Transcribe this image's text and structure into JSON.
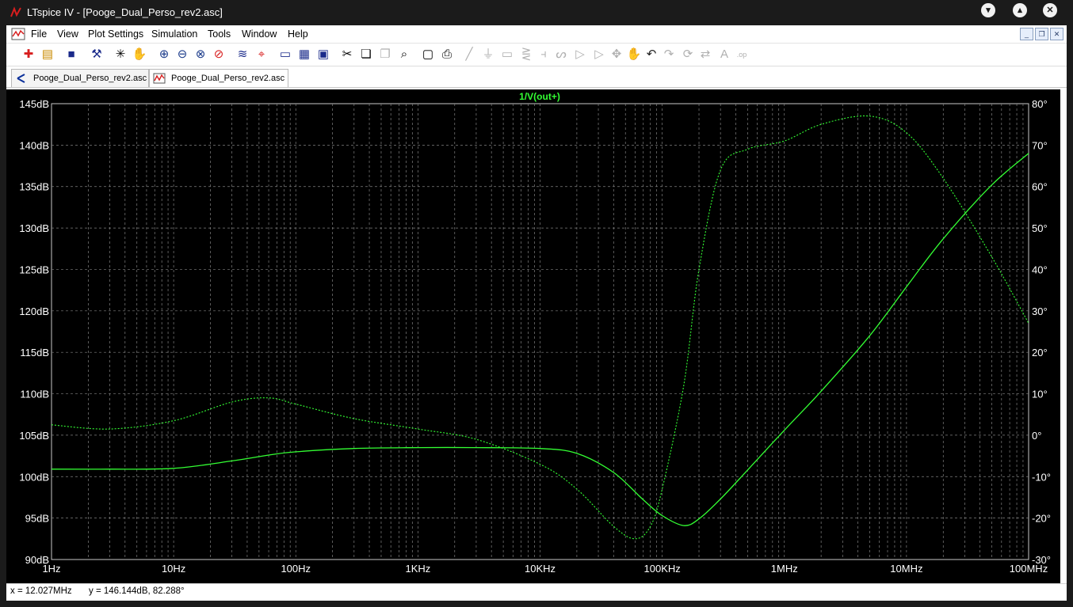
{
  "window": {
    "title": "LTspice IV - [Pooge_Dual_Perso_rev2.asc]"
  },
  "menu": [
    "File",
    "View",
    "Plot Settings",
    "Simulation",
    "Tools",
    "Window",
    "Help"
  ],
  "toolbar_icons": [
    "new-schematic-icon",
    "open-icon",
    "save-icon",
    "control-panel-icon",
    "run-icon",
    "halt-icon",
    "zoom-in-icon",
    "zoom-out-icon",
    "zoom-area-icon",
    "zoom-cancel-icon",
    "autorange-icon",
    "mark-icon",
    "tile-horizontal-icon",
    "tile-vertical-icon",
    "cascade-icon",
    "cut-icon",
    "copy-icon",
    "paste-icon",
    "find-icon",
    "print-setup-icon",
    "print-icon",
    "wire-icon",
    "ground-icon",
    "label-icon",
    "resistor-icon",
    "capacitor-icon",
    "inductor-icon",
    "diode-icon",
    "component-icon",
    "move-icon",
    "drag-icon",
    "undo-icon",
    "redo-icon",
    "rotate-icon",
    "mirror-icon",
    "text-icon",
    "spice-directive-icon"
  ],
  "tabs": [
    {
      "label": "Pooge_Dual_Perso_rev2.asc",
      "icon": "schematic-icon"
    },
    {
      "label": "Pooge_Dual_Perso_rev2.asc",
      "icon": "waveform-icon"
    }
  ],
  "colors": {
    "plot_background": "#000000",
    "trace": "#33ff33",
    "grid": "#808080",
    "axis_text": "#ffffff"
  },
  "chart_data": {
    "type": "line",
    "title": "1/V(out+)",
    "xscale": "log",
    "xlim": [
      1,
      100000000
    ],
    "x_ticks": [
      "1Hz",
      "10Hz",
      "100Hz",
      "1KHz",
      "10KHz",
      "100KHz",
      "1MHz",
      "10MHz",
      "100MHz"
    ],
    "ylim_left": [
      90,
      145
    ],
    "y_ticks_left": [
      "145dB",
      "140dB",
      "135dB",
      "130dB",
      "125dB",
      "120dB",
      "115dB",
      "110dB",
      "105dB",
      "100dB",
      "95dB",
      "90dB"
    ],
    "ylim_right": [
      -30,
      80
    ],
    "y_ticks_right": [
      "80°",
      "70°",
      "60°",
      "50°",
      "40°",
      "30°",
      "20°",
      "10°",
      "0°",
      "-10°",
      "-20°",
      "-30°"
    ],
    "grid": true,
    "series": [
      {
        "axis": "left",
        "style": "solid",
        "x": [
          1,
          3,
          10,
          30,
          60,
          100,
          300,
          1000,
          3000,
          10000,
          20000,
          40000,
          70000,
          100000,
          150000,
          200000,
          300000,
          500000,
          1000000,
          2000000,
          5000000,
          10000000,
          20000000,
          50000000,
          100000000
        ],
        "y": [
          100.9,
          100.9,
          101.0,
          101.9,
          102.6,
          103.0,
          103.4,
          103.5,
          103.5,
          103.4,
          102.8,
          100.5,
          97.2,
          95.3,
          94.1,
          94.9,
          97.3,
          100.8,
          105.6,
          110.3,
          117.0,
          122.9,
          128.7,
          135.2,
          139.0
        ]
      },
      {
        "axis": "right",
        "style": "dashed",
        "x": [
          1,
          3,
          10,
          30,
          60,
          100,
          300,
          1000,
          3000,
          10000,
          20000,
          40000,
          60000,
          80000,
          100000,
          150000,
          200000,
          300000,
          500000,
          1000000,
          2000000,
          5000000,
          10000000,
          20000000,
          50000000,
          100000000
        ],
        "y": [
          2.5,
          1.5,
          3.5,
          8.0,
          9.0,
          7.5,
          4.0,
          1.5,
          -1.0,
          -7.0,
          -13.0,
          -22.0,
          -25.0,
          -22.0,
          -13.0,
          12.0,
          40.0,
          64.0,
          69.0,
          71.0,
          75.0,
          77.0,
          73.0,
          62.0,
          43.0,
          27.0
        ]
      }
    ]
  },
  "status": {
    "x": "x = 12.027MHz",
    "y": "y = 146.144dB, 82.288°"
  }
}
